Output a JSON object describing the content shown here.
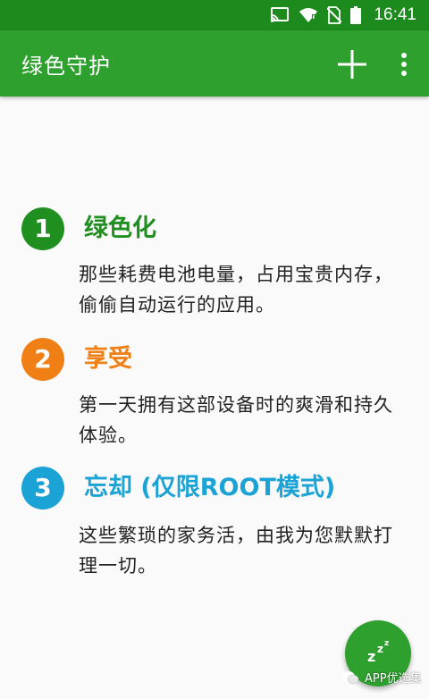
{
  "status_bar": {
    "time": "16:41",
    "icons": [
      "cast-icon",
      "wifi-icon",
      "no-sim-icon",
      "battery-icon"
    ]
  },
  "app_bar": {
    "title": "绿色守护",
    "actions": [
      "plus-icon",
      "more-vert-icon"
    ]
  },
  "features": [
    {
      "number": "1",
      "title": "绿色化",
      "color": "#1f8f1f",
      "description": "那些耗费电池电量，占用宝贵内存，偷偷自动运行的应用。"
    },
    {
      "number": "2",
      "title": "享受",
      "color": "#f07f16",
      "description": "第一天拥有这部设备时的爽滑和持久体验。"
    },
    {
      "number": "3",
      "title": "忘却 (仅限ROOT模式)",
      "color": "#1aa3d4",
      "description": "这些繁琐的家务活，由我为您默默打理一切。"
    }
  ],
  "fab": {
    "label": "zzz",
    "icon": "sleep-icon",
    "color": "#2ea02e"
  },
  "watermark": {
    "text": "APP优选集",
    "icon": "wechat-icon"
  }
}
